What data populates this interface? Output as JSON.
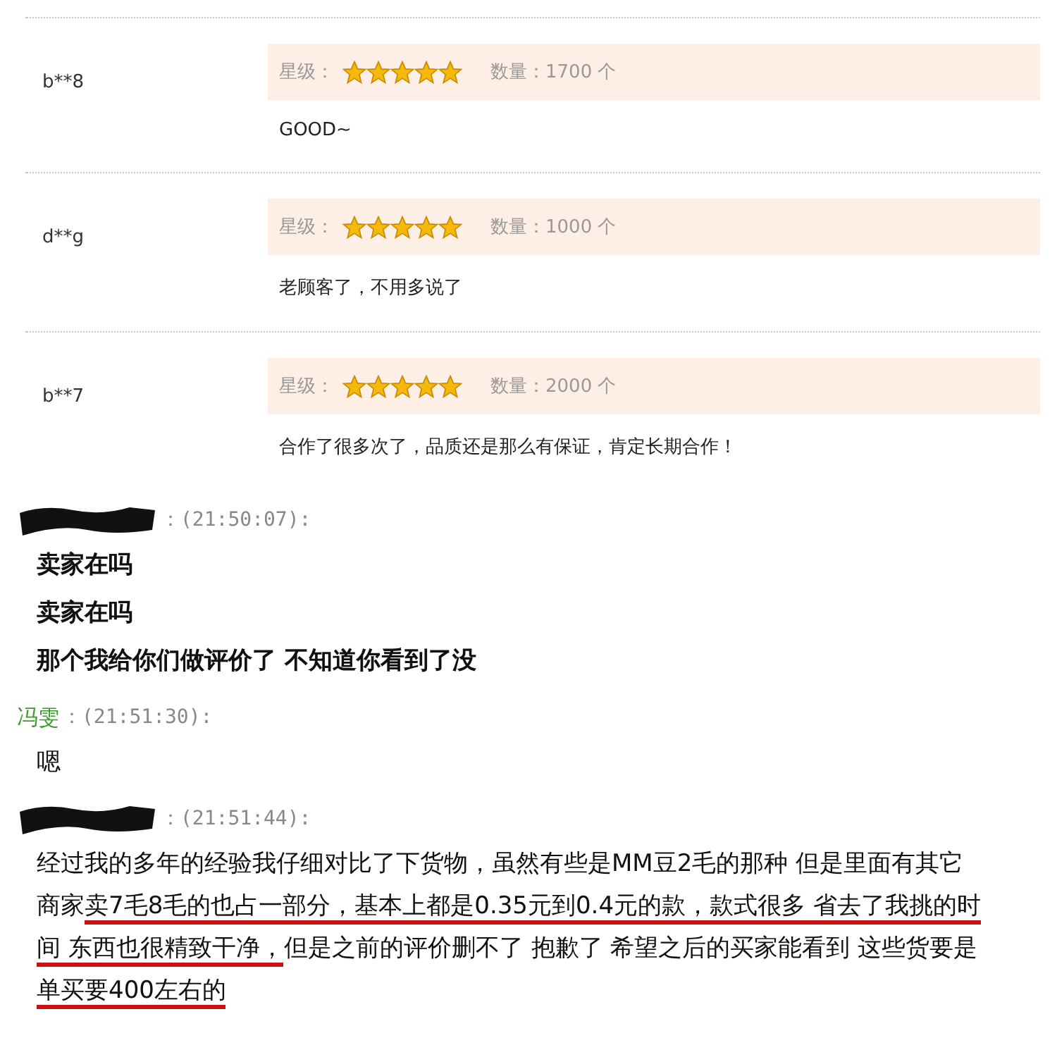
{
  "reviews": [
    {
      "user": "b**8",
      "stars_label": "星级：",
      "stars": 5,
      "quantity": "数量：1700 个",
      "comment": "GOOD~"
    },
    {
      "user": "d**g",
      "stars_label": "星级：",
      "stars": 5,
      "quantity": "数量：1000 个",
      "comment": "老顾客了，不用多说了"
    },
    {
      "user": "b**7",
      "stars_label": "星级：",
      "stars": 5,
      "quantity": "数量：2000 个",
      "comment": "合作了很多次了，品质还是那么有保证，肯定长期合作！"
    }
  ],
  "chat": [
    {
      "kind": "redacted",
      "time": "：(21:50:07):",
      "bold": true,
      "lines": [
        [
          {
            "text": "卖家在吗",
            "underlined": false
          }
        ],
        [
          {
            "text": "卖家在吗",
            "underlined": false
          }
        ],
        [
          {
            "text": "那个我给你们做评价了 不知道你看到了没",
            "underlined": false
          }
        ]
      ]
    },
    {
      "kind": "name",
      "sender": "冯雯",
      "time": "：(21:51:30):",
      "bold": false,
      "lines": [
        [
          {
            "text": "嗯",
            "underlined": false
          }
        ]
      ]
    },
    {
      "kind": "redacted",
      "time": "：(21:51:44):",
      "bold": false,
      "lines": [
        [
          {
            "text": "经过我的多年的经验我仔细对比了下货物，虽然有些是MM豆2毛的那种 但是里面有其它商家",
            "underlined": false
          },
          {
            "text": "卖7毛8毛的也占一部分，基本上都是0.35元到0.4元的款，",
            "underlined": true
          },
          {
            "text": "款式很多 省去了我挑的时间 东西也很精致干净，",
            "underlined": true
          },
          {
            "text": "但是之前的评价删不了 抱歉了 希望之后的买家能看到 这些货要是",
            "underlined": false
          },
          {
            "text": "单买要400左右的",
            "underlined": true
          }
        ]
      ]
    }
  ]
}
